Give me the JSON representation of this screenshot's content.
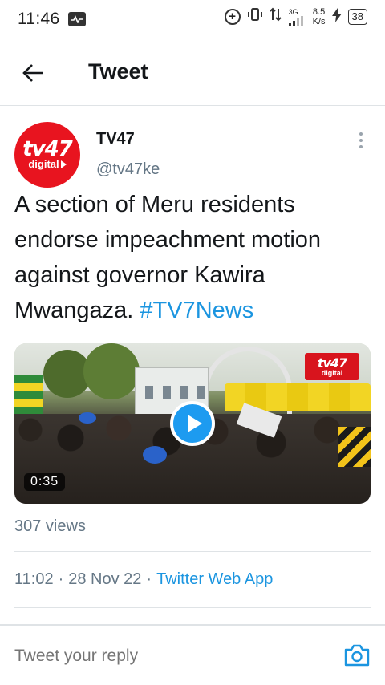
{
  "status_bar": {
    "time": "11:46",
    "network": "3G",
    "speed_value": "8.5",
    "speed_unit": "K/s",
    "battery": "38"
  },
  "header": {
    "title": "Tweet"
  },
  "author": {
    "name": "TV47",
    "handle": "@tv47ke",
    "avatar_line1": "tv47",
    "avatar_line2": "digital"
  },
  "tweet": {
    "text": "A section of Meru residents endorse impeachment motion against governor Kawira Mwangaza.",
    "hashtag": "#TV7News"
  },
  "media": {
    "duration": "0:35",
    "logo_line1": "tv47",
    "logo_line2": "digital"
  },
  "stats": {
    "views": "307 views"
  },
  "meta": {
    "time": "11:02",
    "date": "28 Nov 22",
    "source": "Twitter Web App",
    "separator": "·"
  },
  "reply": {
    "placeholder": "Tweet your reply"
  },
  "colors": {
    "link": "#1b95e0",
    "brand_red": "#e8141f",
    "secondary_text": "#657786"
  }
}
